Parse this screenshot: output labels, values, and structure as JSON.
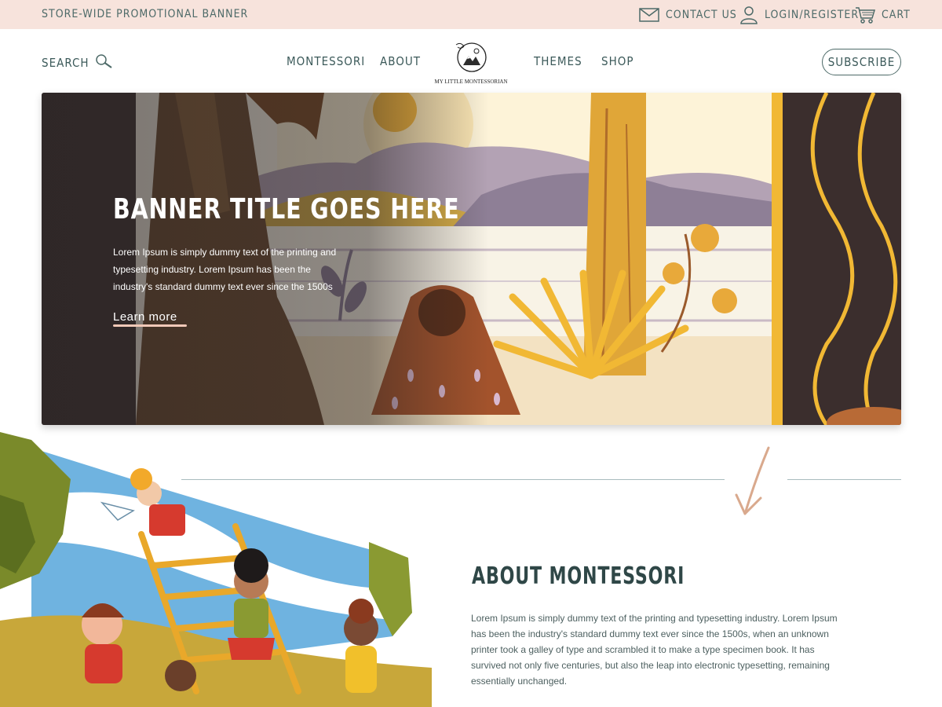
{
  "promo": {
    "banner_text": "Store-wide promotional banner",
    "contact_label": "Contact us",
    "login_label": "Login/Register",
    "cart_label": "Cart"
  },
  "nav": {
    "search_label": "Search",
    "links": [
      "Montessori",
      "About",
      "Themes",
      "Shop"
    ],
    "logo_caption": "My Little Montessorian",
    "subscribe_label": "Subscribe"
  },
  "hero": {
    "title": "Banner title goes here",
    "body": "Lorem Ipsum is simply dummy text of the printing and typesetting industry. Lorem Ipsum has been the industry's standard dummy text ever since the 1500s",
    "cta_label": "Learn more"
  },
  "about": {
    "title": "About Montessori",
    "body": "Lorem Ipsum is simply dummy text of the printing and typesetting industry. Lorem Ipsum has been the industry's standard dummy text ever since the 1500s, when an unknown printer took a galley of type and scrambled it to make a type specimen book. It has survived not only five centuries, but also the leap into electronic typesetting, remaining essentially unchanged."
  },
  "colors": {
    "promo_bg": "#f7e3dc",
    "text_teal": "#3c5a5a",
    "accent_peach": "#f2c9b8",
    "arrow": "#d9a98d"
  },
  "icons": [
    "envelope-icon",
    "user-icon",
    "cart-icon",
    "search-icon",
    "arrow-down-icon"
  ]
}
